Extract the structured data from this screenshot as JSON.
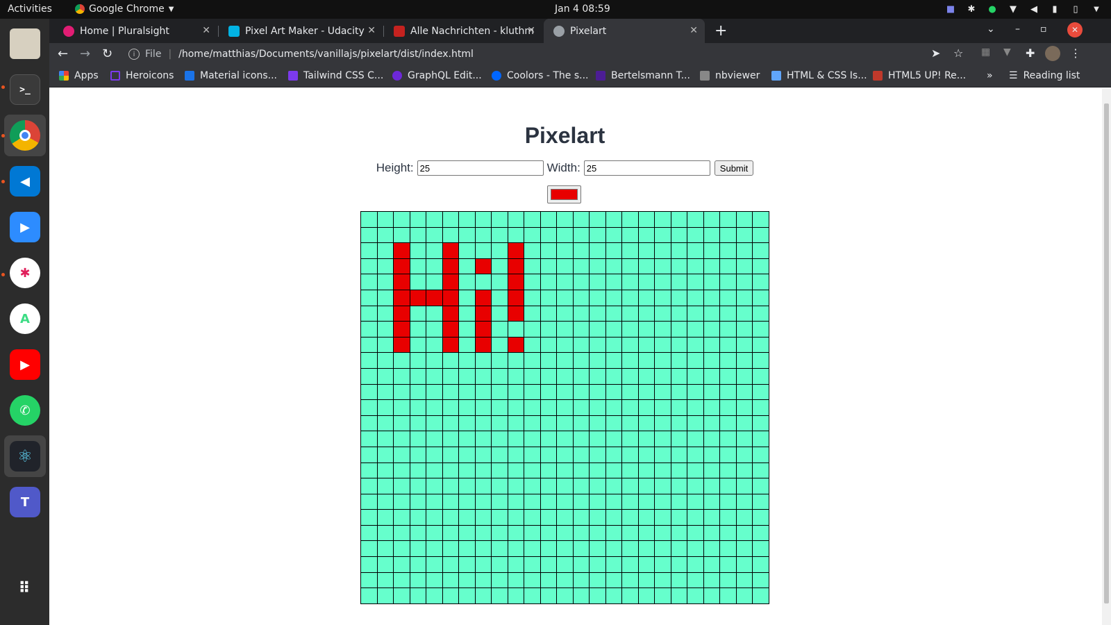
{
  "system": {
    "activities": "Activities",
    "app_name": "Google Chrome",
    "clock": "Jan 4  08:59"
  },
  "browser": {
    "tabs": [
      {
        "title": "Home | Pluralsight",
        "favicon_color": "#e11d74"
      },
      {
        "title": "Pixel Art Maker - Udacity",
        "favicon_color": "#02b3e4"
      },
      {
        "title": "Alle Nachrichten - kluthm",
        "favicon_color": "#c5221f"
      },
      {
        "title": "Pixelart",
        "favicon_color": "#9aa0a6"
      }
    ],
    "active_tab": 3,
    "address": {
      "scheme": "File",
      "url": "/home/matthias/Documents/vanillajs/pixelart/dist/index.html"
    },
    "bookmarks": [
      {
        "label": "Apps",
        "color": "#4285f4"
      },
      {
        "label": "Heroicons",
        "color": "#7c3aed"
      },
      {
        "label": "Material icons...",
        "color": "#1a73e8"
      },
      {
        "label": "Tailwind CSS C...",
        "color": "#7c3aed"
      },
      {
        "label": "GraphQL Edit...",
        "color": "#6d28d9"
      },
      {
        "label": "Coolors - The s...",
        "color": "#0066ff"
      },
      {
        "label": "Bertelsmann T...",
        "color": "#4c1d95"
      },
      {
        "label": "nbviewer",
        "color": "#888888"
      },
      {
        "label": "HTML & CSS Is...",
        "color": "#60a5fa"
      },
      {
        "label": "HTML5 UP! Re...",
        "color": "#c0392b"
      }
    ],
    "reading_list": "Reading list"
  },
  "page": {
    "title": "Pixelart",
    "height_label": "Height:",
    "height_value": "25",
    "width_label": "Width:",
    "width_value": "25",
    "submit_label": "Submit",
    "selected_color": "#e80000",
    "cell_color": "#66ffcc",
    "grid_rows": 25,
    "grid_cols": 25,
    "painted_cells": [
      [
        2,
        2
      ],
      [
        2,
        5
      ],
      [
        2,
        9
      ],
      [
        3,
        2
      ],
      [
        3,
        5
      ],
      [
        3,
        7
      ],
      [
        3,
        9
      ],
      [
        4,
        2
      ],
      [
        4,
        5
      ],
      [
        4,
        9
      ],
      [
        5,
        2
      ],
      [
        5,
        3
      ],
      [
        5,
        4
      ],
      [
        5,
        5
      ],
      [
        5,
        7
      ],
      [
        5,
        9
      ],
      [
        6,
        2
      ],
      [
        6,
        5
      ],
      [
        6,
        7
      ],
      [
        6,
        9
      ],
      [
        7,
        2
      ],
      [
        7,
        5
      ],
      [
        7,
        7
      ],
      [
        8,
        2
      ],
      [
        8,
        5
      ],
      [
        8,
        7
      ],
      [
        8,
        9
      ]
    ]
  }
}
